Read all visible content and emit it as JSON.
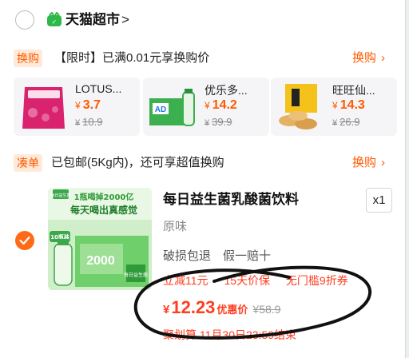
{
  "store": {
    "name": "天猫超市",
    "chevron": ">"
  },
  "swap_section": {
    "badge": "换购",
    "text": "【限时】已满0.01元享换购价",
    "link": "换购",
    "items": [
      {
        "name": "LOTUS...",
        "price": "3.7",
        "orig_price": "10.9",
        "currency": "¥"
      },
      {
        "name": "优乐多...",
        "price": "14.2",
        "orig_price": "39.9",
        "currency": "¥"
      },
      {
        "name": "旺旺仙...",
        "price": "14.3",
        "orig_price": "26.9",
        "currency": "¥"
      }
    ]
  },
  "bundle_section": {
    "badge": "凑单",
    "text": "已包邮(5Kg内)，还可享超值换购",
    "link": "换购"
  },
  "product": {
    "title": "每日益生菌乳酸菌饮料",
    "quantity": "x1",
    "variant": "原味",
    "guarantee": "破损包退　假一赔十",
    "promos": [
      "立减11元",
      "15天价保",
      "无门槛9折券"
    ],
    "currency": "¥",
    "price": "12.23",
    "price_tag": "优惠价",
    "orig_price": "¥58.9",
    "deadline": "聚划算 11月30日23:59结束",
    "image_texts": [
      "1瓶喝掉2000亿",
      "每天喝出真感觉",
      "每日益生菌",
      "10瓶装",
      "2000"
    ],
    "selected": true
  },
  "colors": {
    "accent": "#ff5a00",
    "price_red": "#ff3d1f",
    "badge_bg": "#ffe9d9"
  },
  "icons": [
    "store-logo-icon",
    "check-icon",
    "chevron-right-icon"
  ]
}
